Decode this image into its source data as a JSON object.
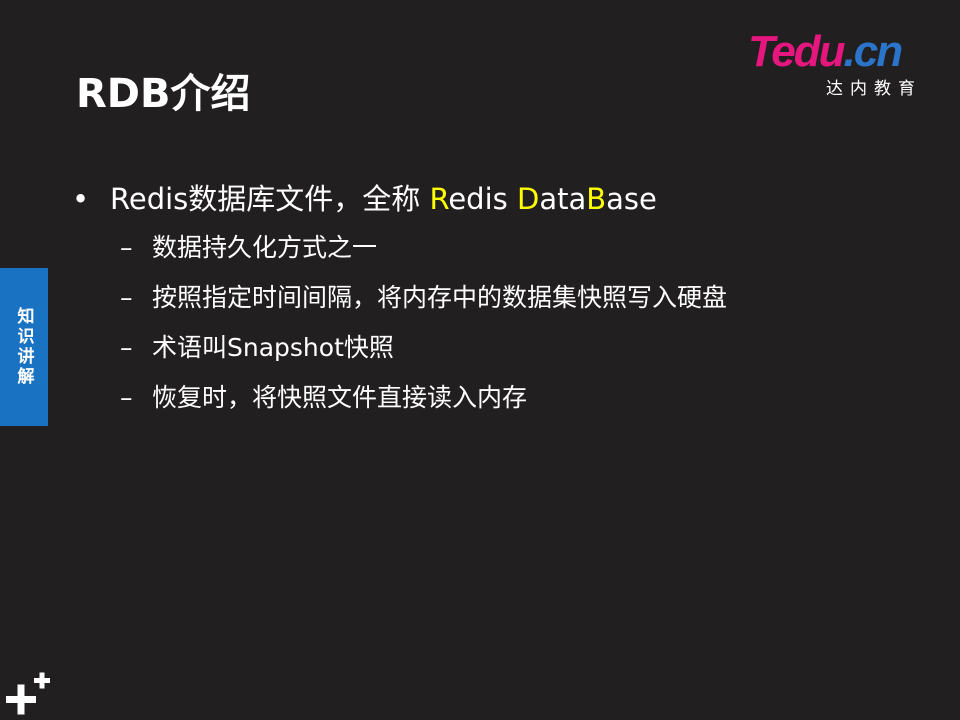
{
  "logo": {
    "text_t": "T",
    "text_rest": "edu",
    "text_dot": ".",
    "text_cn": "cn",
    "subtitle": "达内教育"
  },
  "slide": {
    "title": "RDB介绍",
    "bullet": {
      "symbol": "•",
      "prefix": "Redis数据库文件，全称 ",
      "hl1": "R",
      "mid1": "edis ",
      "hl2": "D",
      "mid2": "ata",
      "hl3": "B",
      "suffix": "ase"
    },
    "sub_bullets": [
      "数据持久化方式之一",
      "按照指定时间间隔，将内存中的数据集快照写入硬盘",
      "术语叫Snapshot快照",
      "恢复时，将快照文件直接读入内存"
    ],
    "dash_symbol": "–"
  },
  "side_tab": {
    "label": "知识讲解"
  },
  "icons": [
    "plus-plus-icon"
  ],
  "colors": {
    "background": "#221f20",
    "highlight": "#ffff00",
    "side_tab": "#1a72c2",
    "logo_pink": "#e5177e",
    "logo_blue": "#2a74c9"
  }
}
